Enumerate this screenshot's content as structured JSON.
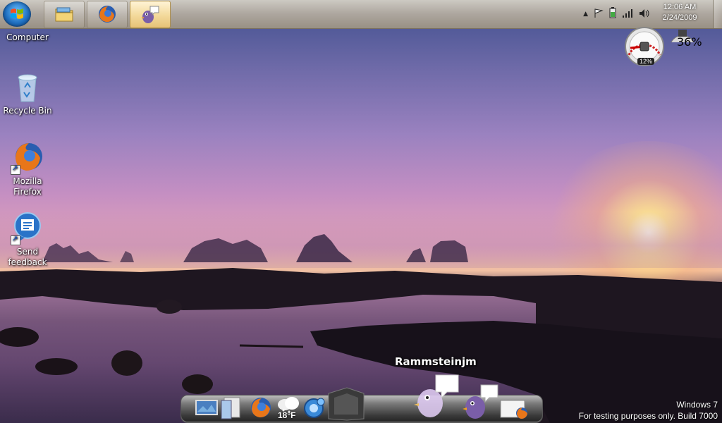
{
  "desktop": {
    "icons": [
      {
        "label_line1": "Computer",
        "label_line2": ""
      },
      {
        "label_line1": "Recycle Bin",
        "label_line2": ""
      },
      {
        "label_line1": "Mozilla",
        "label_line2": "Firefox"
      },
      {
        "label_line1": "Send",
        "label_line2": "feedback"
      }
    ]
  },
  "taskbar": {
    "buttons": [
      {
        "icon": "folder-icon",
        "active": false
      },
      {
        "icon": "firefox-icon",
        "active": false
      },
      {
        "icon": "pidgin-icon",
        "active": true
      }
    ],
    "tray_icons": [
      "show-hidden-icon",
      "flag-icon",
      "battery-icon",
      "signal-icon",
      "volume-icon"
    ],
    "clock": {
      "time": "12:06 AM",
      "date": "2/24/2009"
    }
  },
  "gadgets": {
    "cpu_meter": {
      "cpu_percent": "12%",
      "memory_percent": "36%"
    }
  },
  "dock": {
    "hover_label": "Rammsteinjm",
    "weather_temp": "18°F",
    "items": [
      "desktop-icon",
      "documents-icon",
      "firefox-icon",
      "weather-icon",
      "settings-icon",
      "computer-icon",
      "pidgin-icon",
      "pidgin-icon",
      "firefox-icon"
    ]
  },
  "watermark": {
    "line1": "Windows 7",
    "line2": "For testing purposes only. Build 7000"
  },
  "colors": {
    "taskbar": "#c8bea8",
    "active_button": "#f3d99a",
    "accent": "#1f6fc0"
  }
}
